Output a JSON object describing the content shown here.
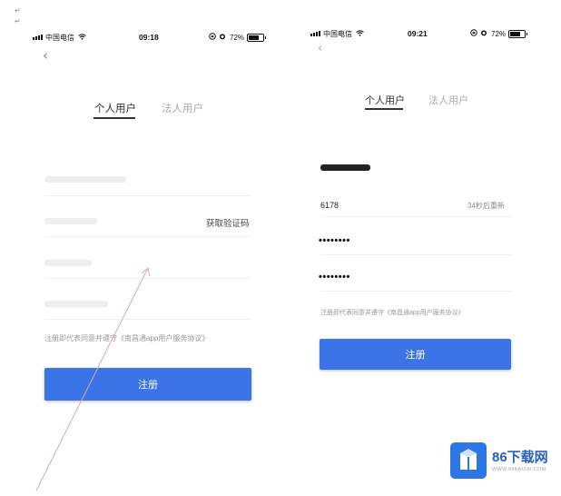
{
  "left_screen": {
    "status": {
      "carrier": "中国电信",
      "time": "09:18",
      "battery": "72%",
      "battery_level": 0.72
    },
    "tabs": [
      {
        "label": "个人用户",
        "active": true
      },
      {
        "label": "法人用户",
        "active": false
      }
    ],
    "get_code_label": "获取验证码",
    "agreement_text": "注册即代表同意并遵守《南昌通app用户服务协议》",
    "register_label": "注册"
  },
  "right_screen": {
    "status": {
      "carrier": "中国电信",
      "time": "09:21",
      "battery": "72%",
      "battery_level": 0.72
    },
    "tabs": [
      {
        "label": "个人用户",
        "active": true
      },
      {
        "label": "法人用户",
        "active": false
      }
    ],
    "code_value": "6178",
    "countdown": "34秒后重新",
    "password_masked": "••••••••",
    "confirm_masked": "••••••••",
    "agreement_text": "注册即代表同意并遵守《南昌通app用户服务协议》",
    "register_label": "注册"
  },
  "watermark": {
    "name": "86下载网",
    "url": "WWW.86KAIZAI.COM"
  },
  "colors": {
    "primary": "#3a74e6",
    "logo": "#2e78e6",
    "text": "#222222",
    "muted": "#aaaaaa"
  },
  "icons": [
    "signal-icon",
    "wifi-icon",
    "lock-rotation-icon",
    "alarm-icon",
    "battery-icon",
    "back-chevron-icon"
  ]
}
